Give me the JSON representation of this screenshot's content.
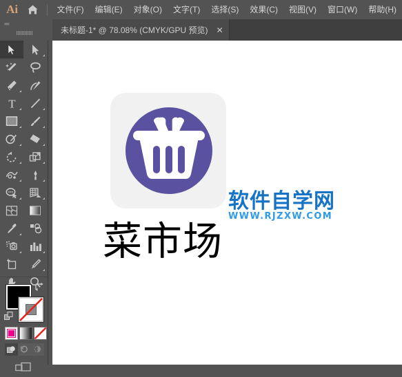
{
  "app": {
    "logo_text": "Ai",
    "logo_color": "#d4a276",
    "home_icon": "home-icon"
  },
  "menubar": {
    "items": [
      {
        "label": "文件(F)",
        "name": "menu-file"
      },
      {
        "label": "编辑(E)",
        "name": "menu-edit"
      },
      {
        "label": "对象(O)",
        "name": "menu-object"
      },
      {
        "label": "文字(T)",
        "name": "menu-type"
      },
      {
        "label": "选择(S)",
        "name": "menu-select"
      },
      {
        "label": "效果(C)",
        "name": "menu-effect"
      },
      {
        "label": "视图(V)",
        "name": "menu-view"
      },
      {
        "label": "窗口(W)",
        "name": "menu-window"
      },
      {
        "label": "帮助(H)",
        "name": "menu-help"
      }
    ]
  },
  "tabbar": {
    "collapse_arrows": "««",
    "document_tab": {
      "title": "未标题-1* @ 78.08% (CMYK/GPU 预览)",
      "close_label": "✕",
      "document_name": "未标题-1*",
      "zoom": "78.08%",
      "color_mode": "CMYK",
      "render_mode": "GPU 预览",
      "modified": true
    }
  },
  "toolpanel": {
    "tools": [
      {
        "name": "selection-tool",
        "label": "选择工具",
        "active": true,
        "has_flyout": false
      },
      {
        "name": "direct-selection-tool",
        "label": "直接选择工具",
        "active": false,
        "has_flyout": true
      },
      {
        "name": "magic-wand-tool",
        "label": "魔棒工具",
        "active": false,
        "has_flyout": false
      },
      {
        "name": "lasso-tool",
        "label": "套索工具",
        "active": false,
        "has_flyout": false
      },
      {
        "name": "pen-tool",
        "label": "钢笔工具",
        "active": false,
        "has_flyout": true
      },
      {
        "name": "curvature-tool",
        "label": "曲率工具",
        "active": false,
        "has_flyout": false
      },
      {
        "name": "type-tool",
        "label": "文字工具",
        "active": false,
        "has_flyout": true
      },
      {
        "name": "line-segment-tool",
        "label": "直线段工具",
        "active": false,
        "has_flyout": true
      },
      {
        "name": "rectangle-tool",
        "label": "矩形工具",
        "active": false,
        "has_flyout": true
      },
      {
        "name": "paintbrush-tool",
        "label": "画笔工具",
        "active": false,
        "has_flyout": true
      },
      {
        "name": "shaper-tool",
        "label": "Shaper 工具",
        "active": false,
        "has_flyout": true
      },
      {
        "name": "eraser-tool",
        "label": "橡皮擦工具",
        "active": false,
        "has_flyout": true
      },
      {
        "name": "rotate-tool",
        "label": "旋转工具",
        "active": false,
        "has_flyout": true
      },
      {
        "name": "scale-tool",
        "label": "比例缩放工具",
        "active": false,
        "has_flyout": true
      },
      {
        "name": "width-tool",
        "label": "宽度工具",
        "active": false,
        "has_flyout": true
      },
      {
        "name": "free-transform-tool",
        "label": "自由变换工具",
        "active": false,
        "has_flyout": true
      },
      {
        "name": "shape-builder-tool",
        "label": "形状生成器工具",
        "active": false,
        "has_flyout": true
      },
      {
        "name": "perspective-grid-tool",
        "label": "透视网格工具",
        "active": false,
        "has_flyout": true
      },
      {
        "name": "mesh-tool",
        "label": "网格工具",
        "active": false,
        "has_flyout": false
      },
      {
        "name": "gradient-tool",
        "label": "渐变工具",
        "active": false,
        "has_flyout": false
      },
      {
        "name": "eyedropper-tool",
        "label": "吸管工具",
        "active": false,
        "has_flyout": true
      },
      {
        "name": "blend-tool",
        "label": "混合工具",
        "active": false,
        "has_flyout": false
      },
      {
        "name": "symbol-sprayer-tool",
        "label": "符号喷枪工具",
        "active": false,
        "has_flyout": true
      },
      {
        "name": "column-graph-tool",
        "label": "柱形图工具",
        "active": false,
        "has_flyout": true
      },
      {
        "name": "artboard-tool",
        "label": "画板工具",
        "active": false,
        "has_flyout": false
      },
      {
        "name": "slice-tool",
        "label": "切片工具",
        "active": false,
        "has_flyout": true
      },
      {
        "name": "hand-tool",
        "label": "抓手工具",
        "active": false,
        "has_flyout": true
      },
      {
        "name": "zoom-tool",
        "label": "缩放工具",
        "active": false,
        "has_flyout": false
      }
    ],
    "color_controls": {
      "fill_color": "#000000",
      "fill_label": "填色",
      "stroke_color": "#ffffff",
      "stroke_label": "描边",
      "stroke_is_none": true,
      "swap_label": "互换填色和描边",
      "default_label": "默认填色和描边",
      "modes": [
        {
          "name": "color-mode-button",
          "label": "颜色",
          "selected": true
        },
        {
          "name": "gradient-mode-button",
          "label": "渐变",
          "selected": false
        },
        {
          "name": "none-mode-button",
          "label": "无",
          "selected": false
        }
      ],
      "draw_modes": [
        {
          "name": "draw-normal-button",
          "label": "正常绘图",
          "selected": true
        },
        {
          "name": "draw-behind-button",
          "label": "背面绘图",
          "selected": false
        },
        {
          "name": "draw-inside-button",
          "label": "内部绘图",
          "selected": false
        }
      ],
      "screen_mode_label": "更改屏幕模式"
    }
  },
  "canvas": {
    "background": "#ffffff",
    "artwork": {
      "logo": {
        "name": "shopping-basket-logo",
        "tile_color": "#f1f1f1",
        "circle_color": "#5a51a0",
        "basket_color": "#ffffff",
        "description": "购物篮图标"
      },
      "watermark": {
        "brand_text": "软件自学网",
        "brand_color": "#1673c6",
        "url_text": "WWW.RJZXW.COM",
        "url_color": "#2f9ae6"
      },
      "headline": {
        "text": "菜市场",
        "color": "#000000"
      }
    }
  }
}
